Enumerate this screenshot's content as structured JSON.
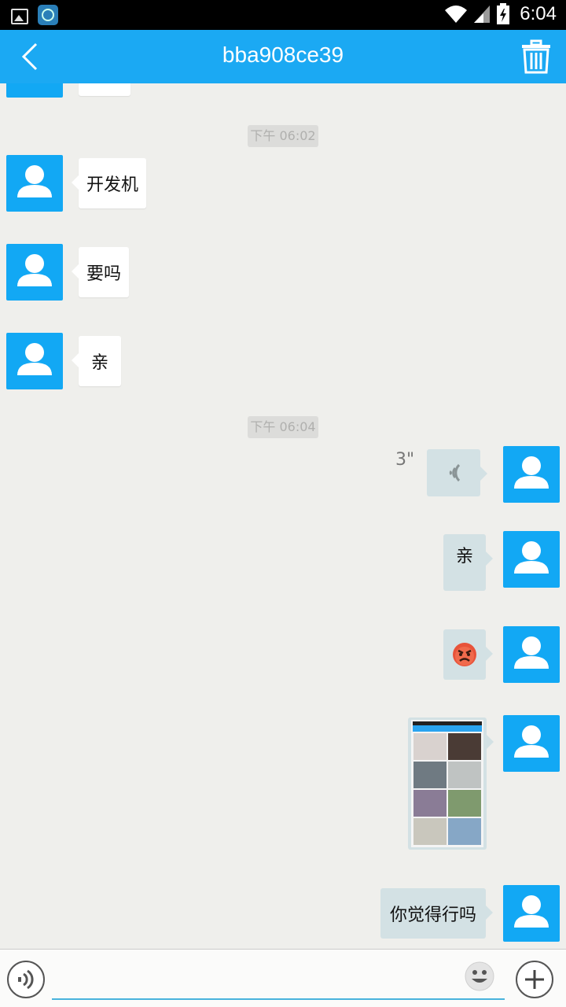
{
  "status_bar": {
    "time": "6:04",
    "icons": [
      "image-icon",
      "app-notification-icon",
      "wifi-icon",
      "signal-icon",
      "battery-icon"
    ]
  },
  "header": {
    "title": "bba908ce39",
    "back_icon": "chevron-left-icon",
    "delete_icon": "trash-icon",
    "background": "#1ba9f3"
  },
  "chat": {
    "timestamps": [
      "下午 06:02",
      "下午 06:04"
    ],
    "incoming": [
      {
        "text": ""
      },
      {
        "text": "开发机"
      },
      {
        "text": "要吗"
      },
      {
        "text": "亲"
      }
    ],
    "outgoing": [
      {
        "type": "voice",
        "duration": "3\""
      },
      {
        "type": "text",
        "text": "亲"
      },
      {
        "type": "emoji",
        "emoji": "angry-face-emoji"
      },
      {
        "type": "image",
        "description": "screenshot-thumbnail"
      },
      {
        "type": "text",
        "text": "你觉得行吗"
      }
    ],
    "outgoing_bubble_color": "#d3e1e4",
    "avatar_color": "#12a8f4"
  },
  "input_bar": {
    "value": "",
    "placeholder": "",
    "voice_icon": "voice-toggle-icon",
    "emoji_icon": "smiley-icon",
    "more_icon": "plus-icon"
  }
}
